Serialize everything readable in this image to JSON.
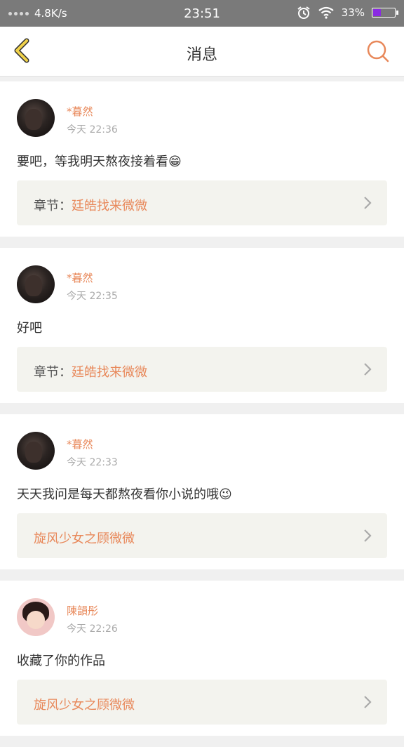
{
  "status_bar": {
    "speed": "4.8K/s",
    "time": "23:51",
    "battery_text": "33%",
    "battery_level": 0.33,
    "icons": [
      "signal-icon",
      "alarm-icon",
      "wifi-icon",
      "battery-icon"
    ]
  },
  "header": {
    "title": "消息",
    "back_icon": "back-chevron-icon",
    "search_icon": "search-icon"
  },
  "colors": {
    "accent": "#e8885a",
    "back_icon": "#f0b040",
    "quote_bg": "#f3f3ee"
  },
  "messages": [
    {
      "name": "*暮然",
      "time": "今天 22:36",
      "text": "要吧，等我明天熬夜接着看",
      "emoji": "😁",
      "quote_prefix": "章节：",
      "quote_link": "廷皓找来微微",
      "avatar": "dark"
    },
    {
      "name": "*暮然",
      "time": "今天 22:35",
      "text": "好吧",
      "emoji": "",
      "quote_prefix": "章节：",
      "quote_link": "廷皓找来微微",
      "avatar": "dark"
    },
    {
      "name": "*暮然",
      "time": "今天 22:33",
      "text": "天天我问是每天都熬夜看你小说的哦",
      "emoji": "😉",
      "quote_prefix": "",
      "quote_link": "旋风少女之顾微微",
      "avatar": "dark"
    },
    {
      "name": "陳韻彤",
      "time": "今天 22:26",
      "text": "收藏了你的作品",
      "emoji": "",
      "quote_prefix": "",
      "quote_link": "旋风少女之顾微微",
      "avatar": "light"
    }
  ]
}
